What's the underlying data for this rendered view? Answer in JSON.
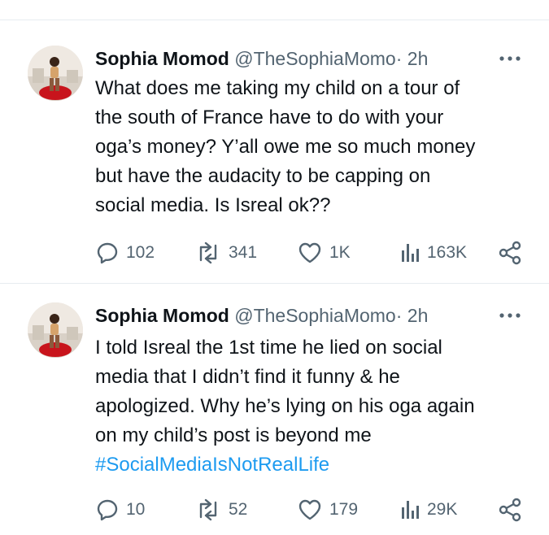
{
  "tweets": [
    {
      "author_name": "Sophia Momod",
      "handle": "@TheSophiaMomo·",
      "separator": "·",
      "time": "2h",
      "text": "What does me taking my child on a tour of\nthe south of France have to do with your\noga’s money? Y’all owe me so much money\nbut have the audacity to be capping on\nsocial media. Is Isreal ok??",
      "hashtag": "",
      "replies": "102",
      "reposts": "341",
      "likes": "1K",
      "views": "163K"
    },
    {
      "author_name": "Sophia Momod",
      "handle": "@TheSophiaMomo·",
      "separator": "·",
      "time": "2h",
      "text": "I told Isreal the 1st time he lied on social\nmedia that I didn’t find it funny & he\napologized. Why he’s lying on his oga again\non my child’s post is beyond me",
      "hashtag": "#SocialMediaIsNotRealLife",
      "replies": "10",
      "reposts": "52",
      "likes": "179",
      "views": "29K"
    }
  ],
  "colors": {
    "text": "#0f1419",
    "secondary": "#536471",
    "link": "#1d9bf0",
    "divider": "#e6ecf0"
  },
  "icons": [
    "reply-icon",
    "repost-icon",
    "like-icon",
    "views-icon",
    "share-icon",
    "more-icon"
  ]
}
